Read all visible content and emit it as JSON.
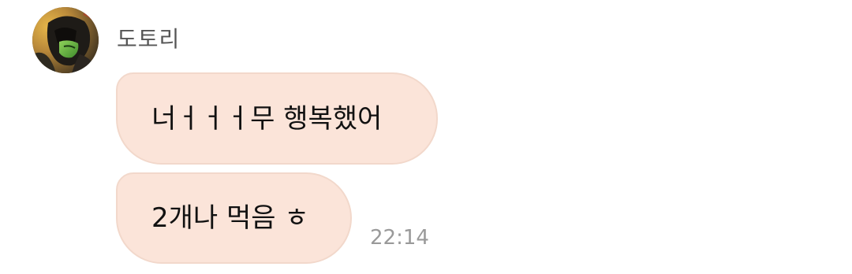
{
  "chat": {
    "sender": {
      "name": "도토리",
      "avatar": "profile-photo"
    },
    "messages": [
      {
        "text": "너ㅓㅓㅓ무 행복했어"
      },
      {
        "text": "2개나 먹음 ㅎ"
      }
    ],
    "timestamp": "22:14"
  },
  "colors": {
    "bubble_fill": "#fbe4d9",
    "bubble_border": "#f2d8cb",
    "name_text": "#555555",
    "time_text": "#9a9a9a",
    "message_text": "#111111"
  }
}
